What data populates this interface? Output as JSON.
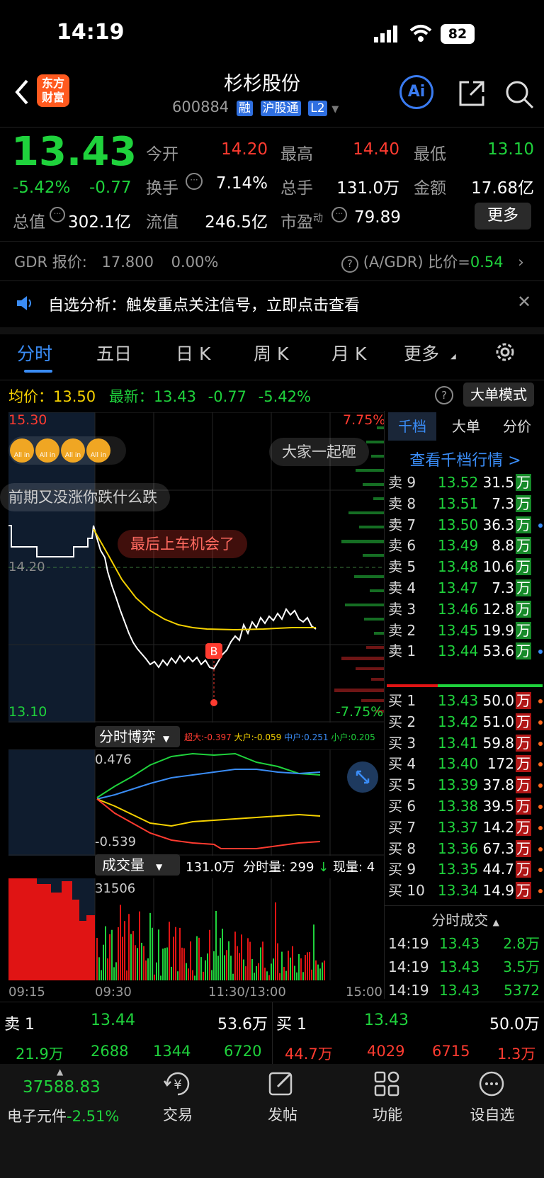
{
  "status_bar": {
    "time": "14:19",
    "battery": "82"
  },
  "header": {
    "title": "杉杉股份",
    "code": "600884",
    "tags": [
      "融",
      "沪股通",
      "L2"
    ],
    "logo": [
      "东方",
      "财富"
    ],
    "ai": "Ai"
  },
  "quote": {
    "price": "13.43",
    "pct": "-5.42%",
    "chg": "-0.77",
    "open_label": "今开",
    "open": "14.20",
    "high_label": "最高",
    "high": "14.40",
    "low_label": "最低",
    "low": "13.10",
    "turnover_label": "换手",
    "turnover": "7.14%",
    "vol_label": "总手",
    "vol": "131.0万",
    "amount_label": "金额",
    "amount": "17.68亿",
    "mcap_label": "总值",
    "mcap": "302.1亿",
    "float_label": "流值",
    "float": "246.5亿",
    "pe_label": "市盈",
    "pe_sup": "动",
    "pe": "79.89",
    "more": "更多"
  },
  "gdr": {
    "label": "GDR 报价:",
    "price": "17.800",
    "pct": "0.00%",
    "ratio_label": "(A/GDR) 比价=",
    "ratio": "0.54"
  },
  "notice": {
    "text": "自选分析：触发重点关注信号，立即点击查看"
  },
  "tabs": [
    "分时",
    "五日",
    "日 K",
    "周 K",
    "月 K",
    "更多"
  ],
  "avg_line": {
    "avg_label": "均价：",
    "avg": "13.50",
    "last_label": "最新：",
    "last": "13.43",
    "chg": "-0.77",
    "pct": "-5.42%",
    "mode_btn": "大单模式"
  },
  "chart": {
    "top_price": "15.30",
    "bottom_price": "13.10",
    "top_pct": "7.75%",
    "bottom_pct": "-7.75%",
    "ref_price": "14.20",
    "marker": "B",
    "comments": [
      "大家一起砸",
      "前期又没涨你跌什么跌",
      "最后上车机会了"
    ],
    "allin": "All in"
  },
  "game": {
    "label": "分时博弈",
    "super": "超大:-0.397",
    "big": "大户:-0.059",
    "mid": "中户:0.251",
    "small": "小户:0.205",
    "max": "0.476",
    "min": "-0.539"
  },
  "volume": {
    "label": "成交量",
    "total": "131.0万",
    "tick_label": "分时量: 299",
    "now_label": "现量: 4",
    "max": "31506"
  },
  "time_axis": [
    "09:15",
    "09:30",
    "11:30/13:00",
    "15:00"
  ],
  "book_tabs": [
    "千档",
    "大单",
    "分价"
  ],
  "book_link": "查看千档行情 >",
  "asks": [
    {
      "l": "卖 9",
      "p": "13.52",
      "v": "31.5",
      "u": "万"
    },
    {
      "l": "卖 8",
      "p": "13.51",
      "v": "7.3",
      "u": "万"
    },
    {
      "l": "卖 7",
      "p": "13.50",
      "v": "36.3",
      "u": "万"
    },
    {
      "l": "卖 6",
      "p": "13.49",
      "v": "8.8",
      "u": "万"
    },
    {
      "l": "卖 5",
      "p": "13.48",
      "v": "10.6",
      "u": "万"
    },
    {
      "l": "卖 4",
      "p": "13.47",
      "v": "7.3",
      "u": "万"
    },
    {
      "l": "卖 3",
      "p": "13.46",
      "v": "12.8",
      "u": "万"
    },
    {
      "l": "卖 2",
      "p": "13.45",
      "v": "19.9",
      "u": "万"
    },
    {
      "l": "卖 1",
      "p": "13.44",
      "v": "53.6",
      "u": "万"
    }
  ],
  "bids": [
    {
      "l": "买 1",
      "p": "13.43",
      "v": "50.0",
      "u": "万"
    },
    {
      "l": "买 2",
      "p": "13.42",
      "v": "51.0",
      "u": "万"
    },
    {
      "l": "买 3",
      "p": "13.41",
      "v": "59.8",
      "u": "万"
    },
    {
      "l": "买 4",
      "p": "13.40",
      "v": "172",
      "u": "万"
    },
    {
      "l": "买 5",
      "p": "13.39",
      "v": "37.8",
      "u": "万"
    },
    {
      "l": "买 6",
      "p": "13.38",
      "v": "39.5",
      "u": "万"
    },
    {
      "l": "买 7",
      "p": "13.37",
      "v": "14.2",
      "u": "万"
    },
    {
      "l": "买 8",
      "p": "13.36",
      "v": "67.3",
      "u": "万"
    },
    {
      "l": "买 9",
      "p": "13.35",
      "v": "44.7",
      "u": "万"
    },
    {
      "l": "买 10",
      "p": "13.34",
      "v": "14.9",
      "u": "万"
    }
  ],
  "ticks_title": "分时成交",
  "ticks": [
    {
      "t": "14:19",
      "p": "13.43",
      "v": "2.8万"
    },
    {
      "t": "14:19",
      "p": "13.43",
      "v": "3.5万"
    },
    {
      "t": "14:19",
      "p": "13.43",
      "v": "5372"
    }
  ],
  "bottom_book": {
    "sell_label": "卖 1",
    "sell_price": "13.44",
    "sell_vol": "53.6万",
    "buy_label": "买 1",
    "buy_price": "13.43",
    "buy_vol": "50.0万",
    "row2": [
      "21.9万",
      "2688",
      "1344",
      "6720",
      "44.7万",
      "4029",
      "6715",
      "1.3万"
    ]
  },
  "index": {
    "value": "37588.83",
    "name": "电子元件",
    "pct": "-2.51%"
  },
  "nav": [
    "交易",
    "发帖",
    "功能",
    "设自选"
  ],
  "colors": {
    "up": "#ff3b30",
    "down": "#1fd23c",
    "accent": "#2f6fe0",
    "avg": "#f5d100"
  }
}
